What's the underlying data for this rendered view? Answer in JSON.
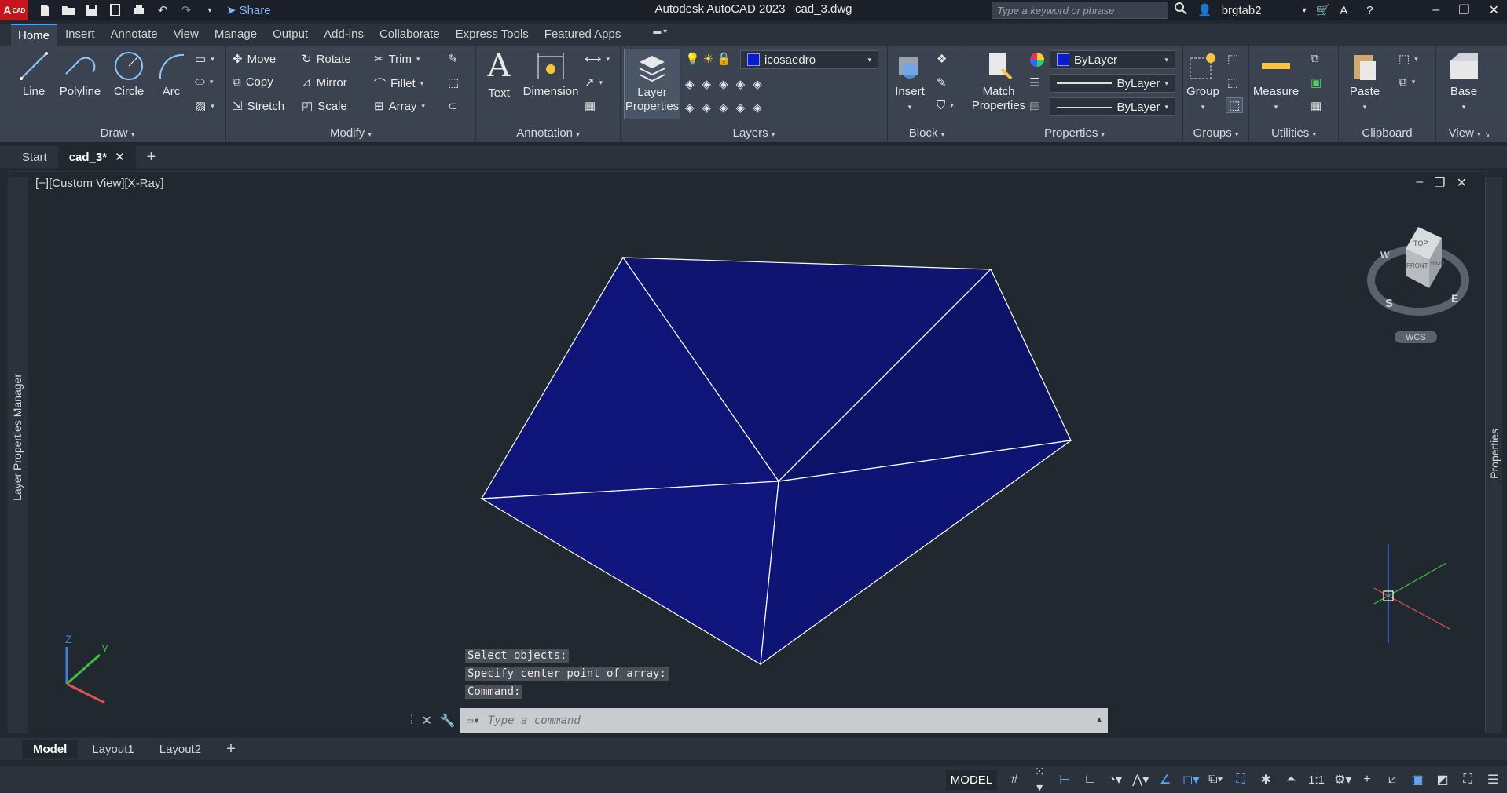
{
  "app": {
    "title": "Autodesk AutoCAD 2023",
    "file": "cad_3.dwg",
    "logo": "A",
    "logo_sub": "CAD"
  },
  "quick_access": {
    "share_label": "Share"
  },
  "search": {
    "placeholder": "Type a keyword or phrase"
  },
  "user": {
    "name": "brgtab2"
  },
  "ribbon_tabs": [
    "Home",
    "Insert",
    "Annotate",
    "View",
    "Manage",
    "Output",
    "Add-ins",
    "Collaborate",
    "Express Tools",
    "Featured Apps"
  ],
  "ribbon": {
    "draw": {
      "title": "Draw",
      "line": "Line",
      "polyline": "Polyline",
      "circle": "Circle",
      "arc": "Arc"
    },
    "modify": {
      "title": "Modify",
      "move": "Move",
      "rotate": "Rotate",
      "trim": "Trim",
      "copy": "Copy",
      "mirror": "Mirror",
      "fillet": "Fillet",
      "stretch": "Stretch",
      "scale": "Scale",
      "array": "Array"
    },
    "annotation": {
      "title": "Annotation",
      "text": "Text",
      "dimension": "Dimension"
    },
    "layers": {
      "title": "Layers",
      "layer_properties_1": "Layer",
      "layer_properties_2": "Properties",
      "current_layer": "icosaedro"
    },
    "block": {
      "title": "Block",
      "insert": "Insert"
    },
    "properties": {
      "title": "Properties",
      "match_1": "Match",
      "match_2": "Properties",
      "color": "ByLayer",
      "linetype": "ByLayer",
      "lineweight": "ByLayer"
    },
    "groups": {
      "title": "Groups",
      "group": "Group"
    },
    "utilities": {
      "title": "Utilities",
      "measure": "Measure"
    },
    "clipboard": {
      "title": "Clipboard",
      "paste": "Paste"
    },
    "view": {
      "title": "View",
      "base": "Base"
    }
  },
  "doc_tabs": {
    "start": "Start",
    "active": "cad_3*"
  },
  "viewport": {
    "label": "[−][Custom View][X-Ray]"
  },
  "palettes": {
    "left": "Layer Properties Manager",
    "right": "Properties"
  },
  "viewcube": {
    "top": "TOP",
    "front": "FRONT",
    "right": "RIGHT",
    "s": "S",
    "e": "E",
    "w": "W",
    "wcs": "WCS"
  },
  "ucs": {
    "z": "Z",
    "y": "Y"
  },
  "command": {
    "history": [
      "Select objects:",
      "Specify center point of array:",
      "Command:"
    ],
    "placeholder": "Type a command"
  },
  "layout_tabs": [
    "Model",
    "Layout1",
    "Layout2"
  ],
  "status": {
    "model": "MODEL",
    "scale": "1:1"
  },
  "colors": {
    "mesh_fill": "#10157a",
    "accent": "#4a9ff5",
    "background": "#212830"
  }
}
